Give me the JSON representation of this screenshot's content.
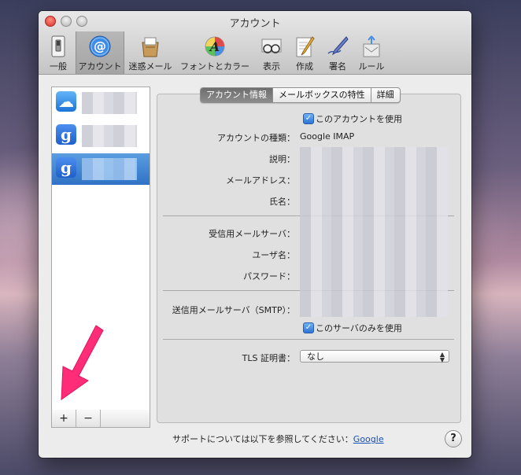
{
  "window": {
    "title": "アカウント"
  },
  "toolbar": {
    "items": [
      {
        "label": "一般",
        "icon": "switch-icon"
      },
      {
        "label": "アカウント",
        "icon": "at-sign-icon",
        "selected": true
      },
      {
        "label": "迷惑メール",
        "icon": "junk-mail-icon"
      },
      {
        "label": "フォントとカラー",
        "icon": "font-color-icon"
      },
      {
        "label": "表示",
        "icon": "glasses-icon"
      },
      {
        "label": "作成",
        "icon": "compose-pencil-icon"
      },
      {
        "label": "署名",
        "icon": "signature-pen-icon"
      },
      {
        "label": "ルール",
        "icon": "rules-icon"
      }
    ]
  },
  "accounts": [
    {
      "icon": "icloud-icon",
      "glyph": "☁"
    },
    {
      "icon": "google-icon",
      "glyph": "g"
    },
    {
      "icon": "google-icon",
      "glyph": "g",
      "selected": true
    }
  ],
  "list_buttons": {
    "add": "+",
    "remove": "−"
  },
  "tabs": [
    {
      "label": "アカウント情報",
      "active": true
    },
    {
      "label": "メールボックスの特性"
    },
    {
      "label": "詳細"
    }
  ],
  "form": {
    "use_account": {
      "label": "このアカウントを使用",
      "checked": true
    },
    "account_type": {
      "label": "アカウントの種類：",
      "value": "Google IMAP"
    },
    "description": {
      "label": "説明："
    },
    "email": {
      "label": "メールアドレス："
    },
    "full_name": {
      "label": "氏名："
    },
    "incoming_server": {
      "label": "受信用メールサーバ："
    },
    "username": {
      "label": "ユーザ名："
    },
    "password": {
      "label": "パスワード："
    },
    "outgoing_server": {
      "label": "送信用メールサーバ（SMTP）："
    },
    "use_only_this_server": {
      "label": "このサーバのみを使用",
      "checked": true
    },
    "tls_certificate": {
      "label": "TLS 証明書：",
      "value": "なし"
    }
  },
  "footer": {
    "support_text": "サポートについては以下を参照してください：",
    "support_link": "Google",
    "help": "?"
  },
  "colors": {
    "accent": "#2f72c5",
    "annotation_arrow": "#ff2d78"
  }
}
